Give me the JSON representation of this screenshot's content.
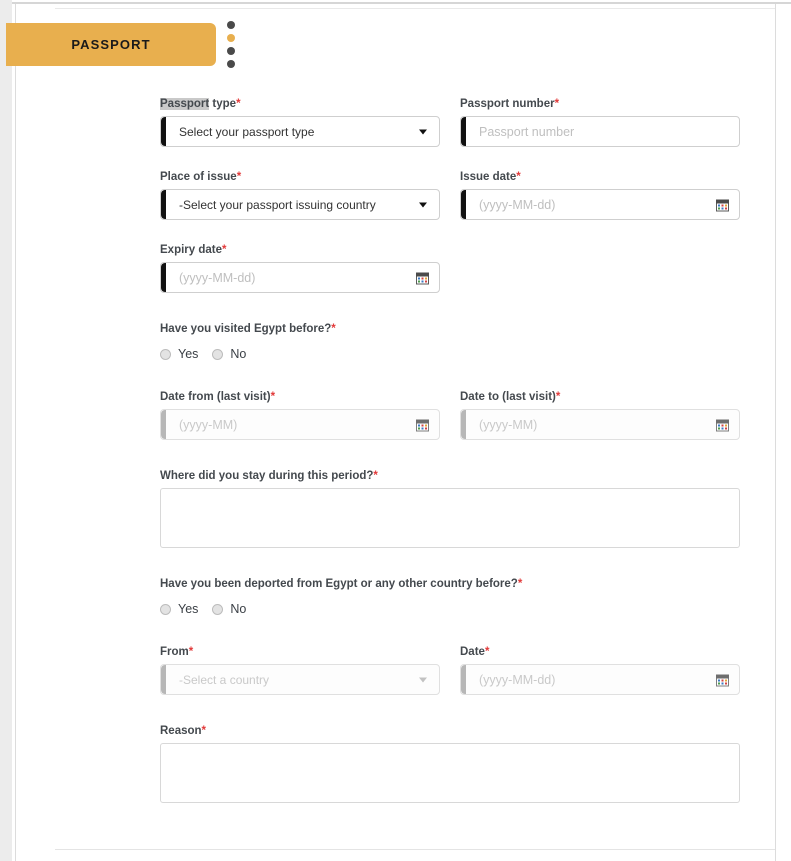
{
  "section": {
    "tab_label": "PASSPORT",
    "accent_color": "#e8af4e",
    "step_dots": [
      {
        "state": "inactive"
      },
      {
        "state": "active"
      },
      {
        "state": "inactive"
      },
      {
        "state": "inactive"
      }
    ]
  },
  "form": {
    "required_marker": "*",
    "fields": {
      "passport_type": {
        "label_selected": "Passport",
        "label_rest": " type",
        "value": "Select your passport type",
        "control": "select",
        "enabled": true
      },
      "passport_number": {
        "label": "Passport number",
        "placeholder": "Passport number",
        "control": "text",
        "enabled": true
      },
      "place_of_issue": {
        "label": "Place of issue",
        "value": "-Select your passport issuing country",
        "control": "select",
        "enabled": true
      },
      "issue_date": {
        "label": "Issue date",
        "placeholder": "(yyyy-MM-dd)",
        "control": "date",
        "enabled": true
      },
      "expiry_date": {
        "label": "Expiry date",
        "placeholder": "(yyyy-MM-dd)",
        "control": "date",
        "enabled": true
      },
      "visited_egypt": {
        "label": "Have you visited Egypt before?",
        "options": [
          "Yes",
          "No"
        ],
        "selected": null
      },
      "date_from_last_visit": {
        "label": "Date from (last visit)",
        "placeholder": "(yyyy-MM)",
        "control": "date",
        "enabled": false
      },
      "date_to_last_visit": {
        "label": "Date to (last visit)",
        "placeholder": "(yyyy-MM)",
        "control": "date",
        "enabled": false
      },
      "stay_location": {
        "label": "Where did you stay during this period?",
        "value": "",
        "control": "textarea"
      },
      "deported": {
        "label": "Have you been deported from Egypt or any other country before?",
        "options": [
          "Yes",
          "No"
        ],
        "selected": null
      },
      "deported_from": {
        "label": "From",
        "value": "-Select a country",
        "control": "select",
        "enabled": false
      },
      "deported_date": {
        "label": "Date",
        "placeholder": "(yyyy-MM-dd)",
        "control": "date",
        "enabled": false
      },
      "deported_reason": {
        "label": "Reason",
        "value": "",
        "control": "textarea"
      }
    }
  }
}
